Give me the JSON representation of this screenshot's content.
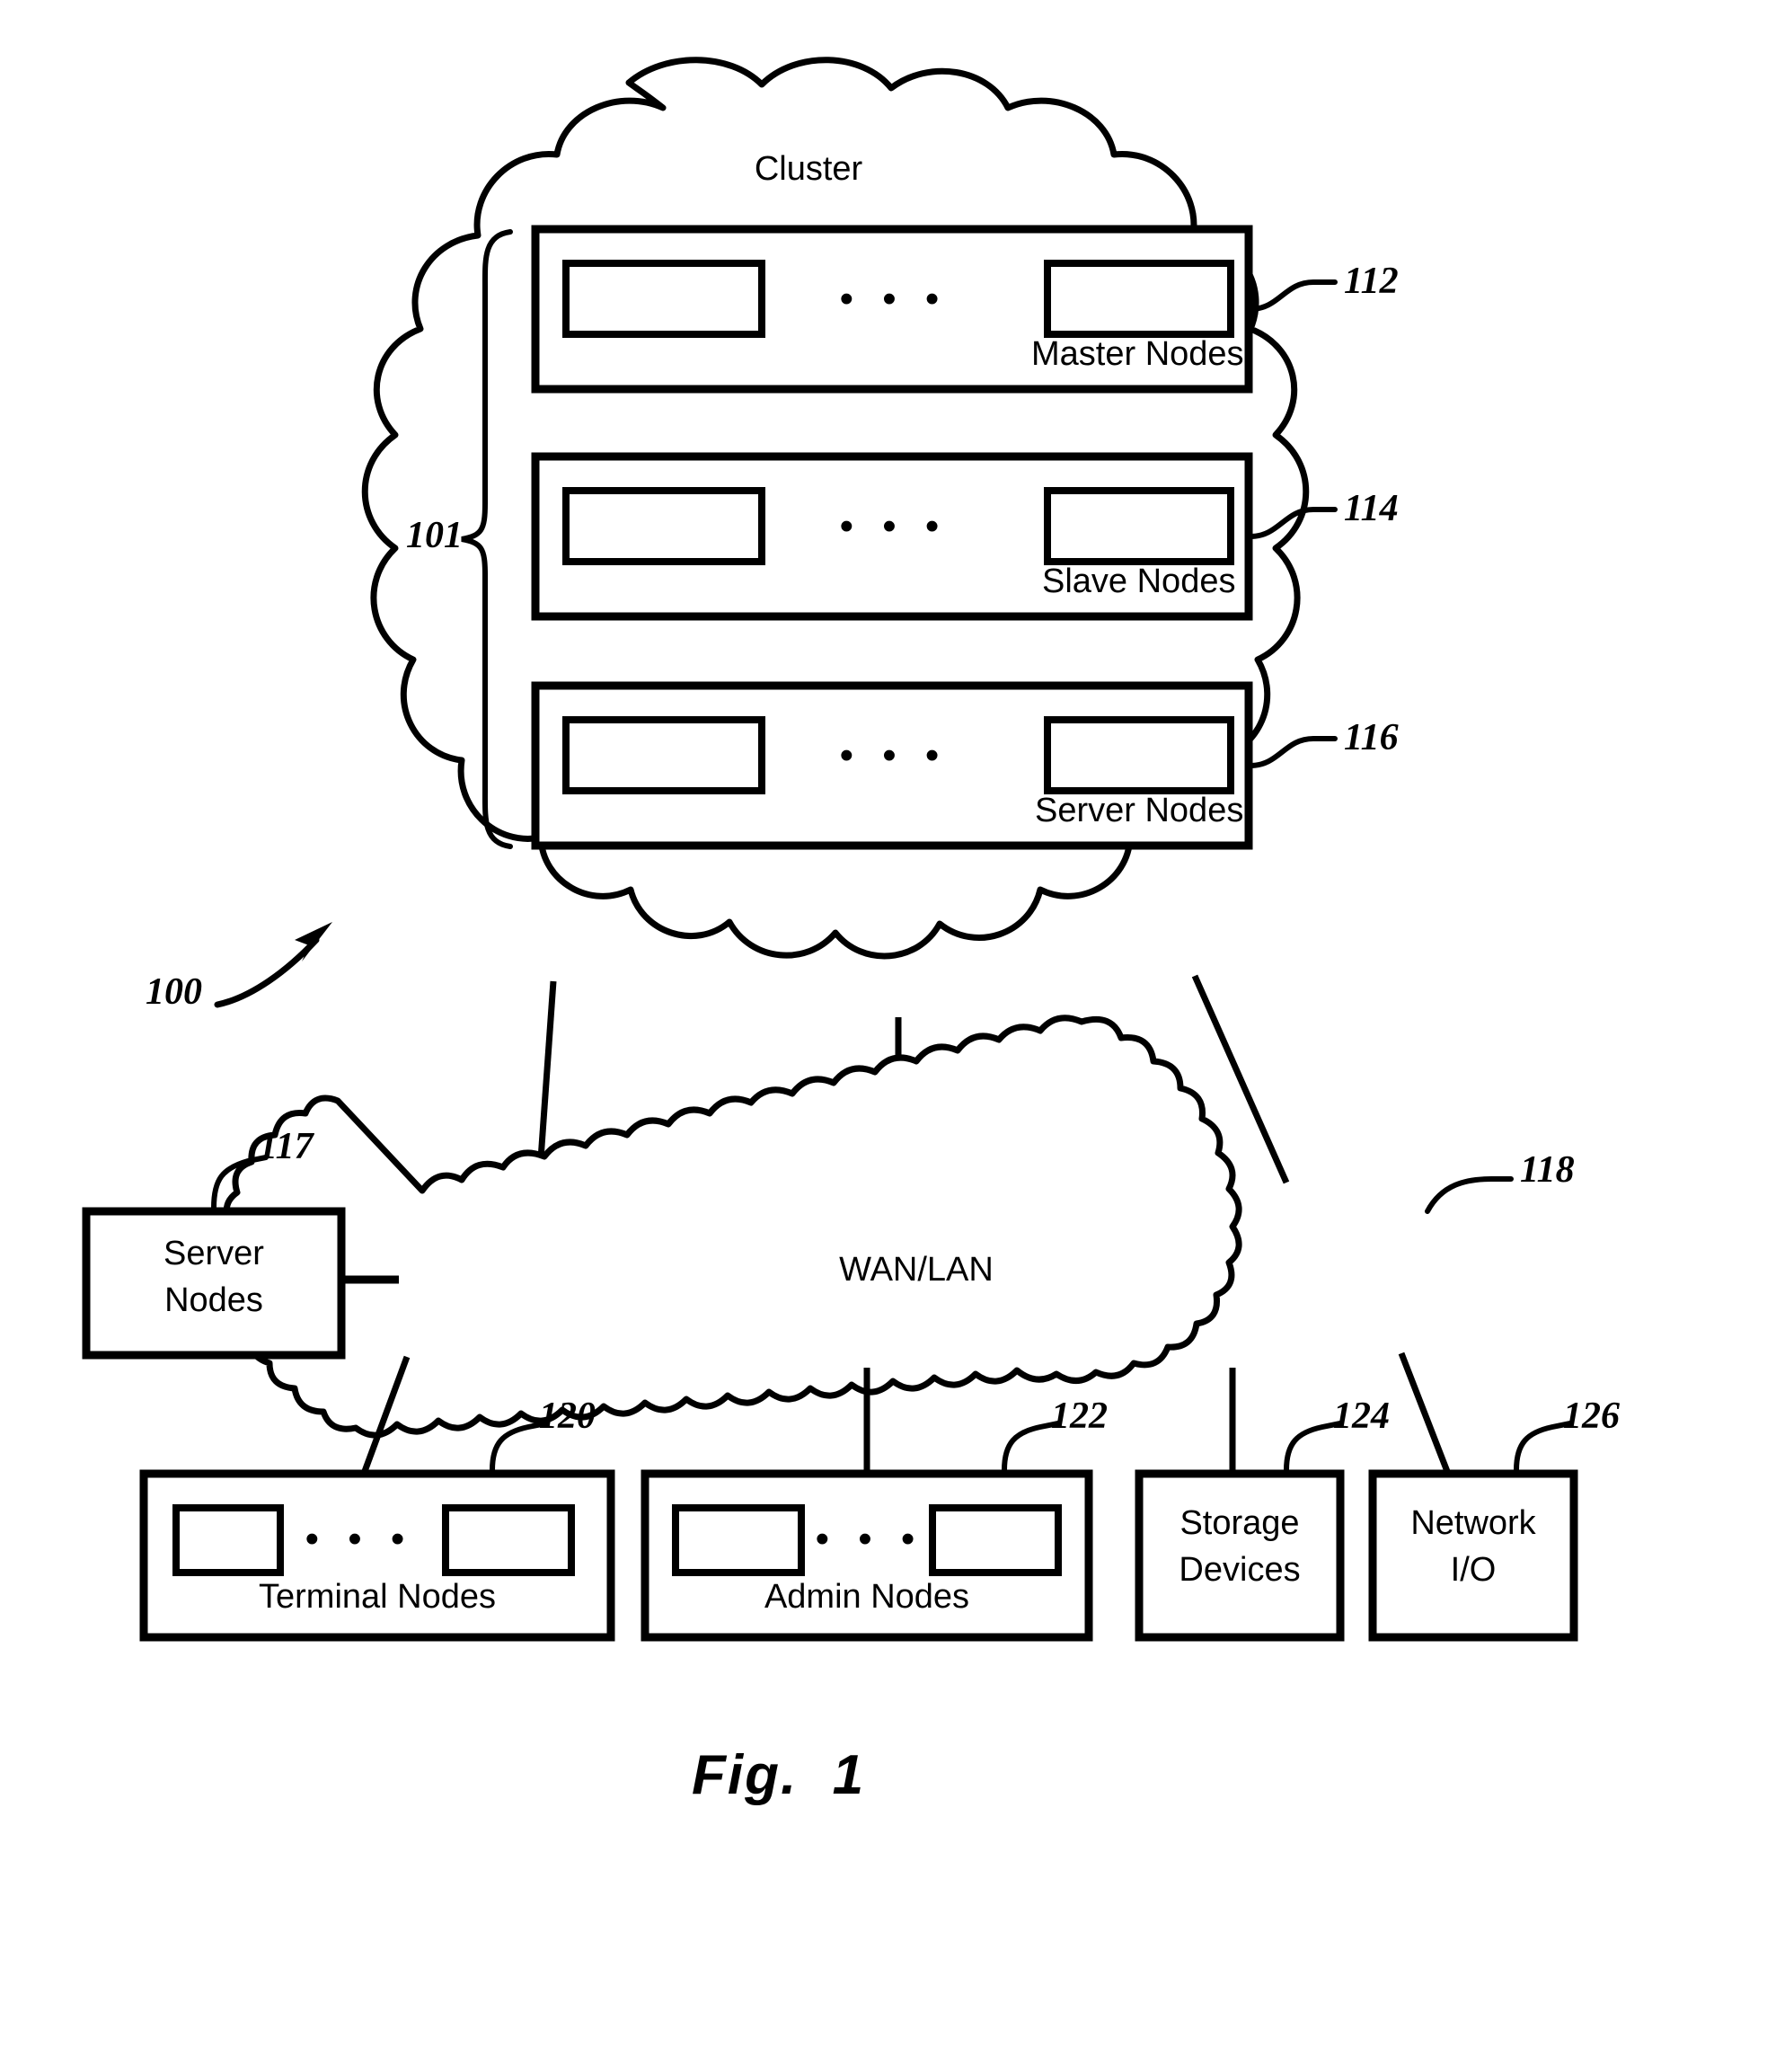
{
  "figure": {
    "caption": "Fig.  1",
    "system_ref": "100",
    "cluster_label": "Cluster",
    "cluster_group_ref": "101",
    "network_label": "WAN/LAN",
    "network_ref": "118"
  },
  "cluster": {
    "label": "Cluster",
    "group_ref": "101",
    "rows": [
      {
        "label": "Master Nodes",
        "ref": "112",
        "ellipsis": "• • •"
      },
      {
        "label": "Slave Nodes",
        "ref": "114",
        "ellipsis": "• • •"
      },
      {
        "label": "Server Nodes",
        "ref": "116",
        "ellipsis": "• • •"
      }
    ]
  },
  "peripherals": {
    "server_nodes": {
      "line1": "Server",
      "line2": "Nodes",
      "ref": "117"
    },
    "terminal_nodes": {
      "label": "Terminal Nodes",
      "ref": "120",
      "ellipsis": "• • •"
    },
    "admin_nodes": {
      "label": "Admin Nodes",
      "ref": "122",
      "ellipsis": "• • •"
    },
    "storage_devices": {
      "line1": "Storage",
      "line2": "Devices",
      "ref": "124"
    },
    "network_io": {
      "line1": "Network",
      "line2": "I/O",
      "ref": "126"
    }
  },
  "style": {
    "stroke": "#000000",
    "fill": "#ffffff"
  }
}
